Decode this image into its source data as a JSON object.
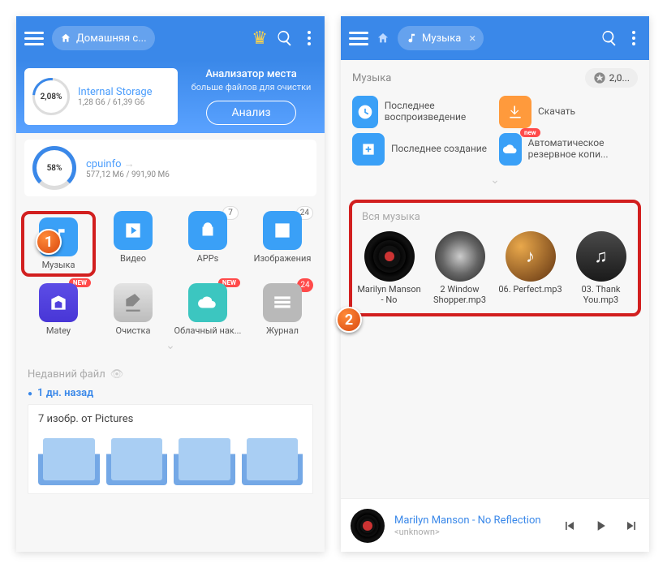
{
  "left": {
    "topbar": {
      "chip_label": "Домашняя с..."
    },
    "storage1": {
      "percent": "2,08%",
      "name": "Internal Storage",
      "usage": "1,28 G6 / 61,39 G6"
    },
    "analysis": {
      "heading": "Анализатор места",
      "sub": "больше файлов для очистки",
      "button": "Анализ"
    },
    "storage2": {
      "percent": "58%",
      "name": "cpuinfo",
      "usage": "577,12 М6 / 991,90 М6"
    },
    "categories": {
      "music": "Музыка",
      "video": "Видео",
      "apps": "APPs",
      "apps_count": "7",
      "images": "Изображения",
      "images_count": "24",
      "matey": "Matey",
      "clean": "Очистка",
      "cloud": "Облачный нак...",
      "log": "Журнал",
      "log_count": "24",
      "new_badge": "NEW"
    },
    "recent": {
      "section": "Недавний файл",
      "time": "1 дн. назад",
      "card_title": "7 изобр. от Pictures"
    }
  },
  "right": {
    "topbar": {
      "chip_label": "Музыка"
    },
    "sub_label": "Музыка",
    "size_pill": "2,0...",
    "quick": {
      "recent_play": "Последнее воспроизведение",
      "download": "Скачать",
      "recent_create": "Последнее создание",
      "backup": "Автоматическое резервное копи...",
      "new_badge": "new"
    },
    "all_music": "Вся музыка",
    "tracks": {
      "t1": "Marilyn Manson - No",
      "t2": "2 Window Shopper.mp3",
      "t3": "06. Perfect.mp3",
      "t4": "03. Thank You.mp3"
    },
    "player": {
      "title": "Marilyn Manson - No Reflection",
      "artist": "<unknown>"
    }
  },
  "callouts": {
    "one": "1",
    "two": "2"
  }
}
